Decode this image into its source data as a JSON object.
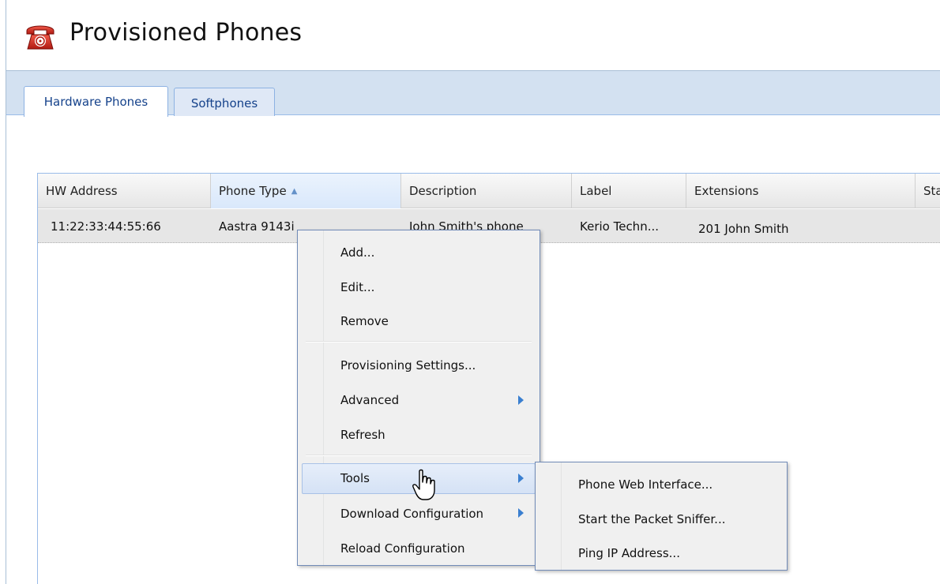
{
  "header": {
    "title": "Provisioned Phones",
    "icon": "phone-icon"
  },
  "tabs": [
    {
      "label": "Hardware Phones",
      "active": true
    },
    {
      "label": "Softphones",
      "active": false
    }
  ],
  "grid": {
    "columns": [
      {
        "label": "HW Address"
      },
      {
        "label": "Phone Type",
        "sorted": "ascending"
      },
      {
        "label": "Description"
      },
      {
        "label": "Label"
      },
      {
        "label": "Extensions"
      },
      {
        "label": "Sta"
      }
    ],
    "rows": [
      {
        "hw_address": "11:22:33:44:55:66",
        "phone_type": "Aastra 9143i",
        "description": "John Smith's phone",
        "label": "Kerio Techn...",
        "extensions": "201 John Smith"
      }
    ]
  },
  "context_menu": {
    "items": [
      {
        "label": "Add..."
      },
      {
        "label": "Edit..."
      },
      {
        "label": "Remove"
      },
      {
        "label": "Provisioning Settings..."
      },
      {
        "label": "Advanced",
        "submenu": true
      },
      {
        "label": "Refresh"
      },
      {
        "label": "Tools",
        "submenu": true,
        "active": true
      },
      {
        "label": "Download Configuration",
        "submenu": true
      },
      {
        "label": "Reload Configuration"
      }
    ]
  },
  "tools_submenu": {
    "items": [
      {
        "label": "Phone Web Interface..."
      },
      {
        "label": "Start the Packet Sniffer..."
      },
      {
        "label": "Ping IP Address..."
      }
    ]
  },
  "colors": {
    "accent": "#d3e1f1",
    "tab_text": "#15428b",
    "menu_border": "#718bb7",
    "icon_red": "#c8261c"
  }
}
